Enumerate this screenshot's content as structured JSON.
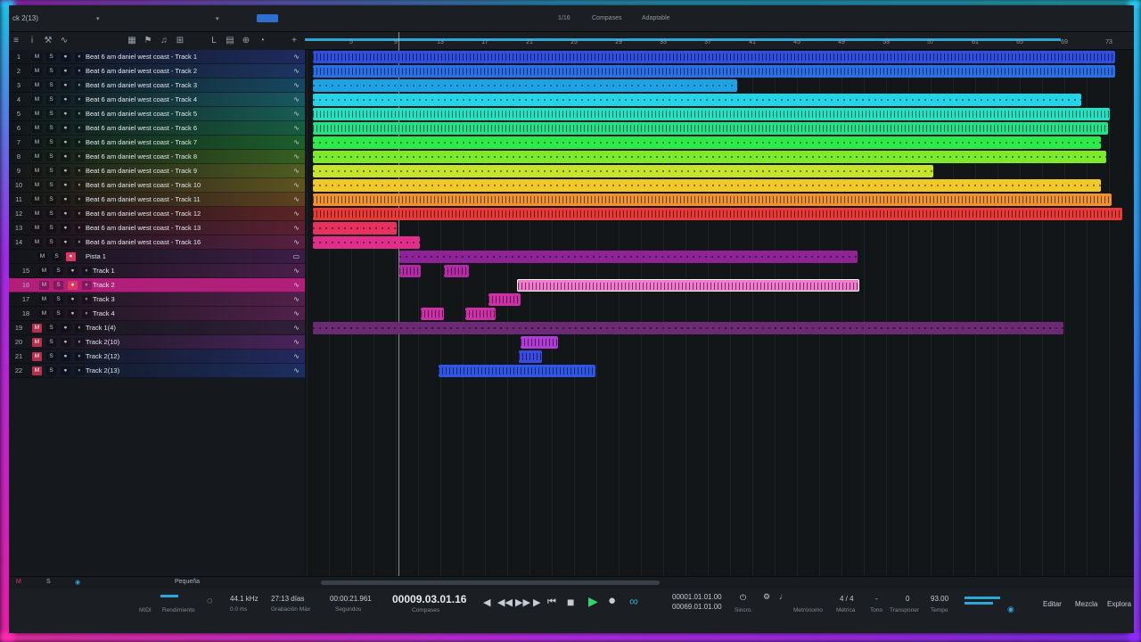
{
  "app": {
    "song_title": "ck 2(13)"
  },
  "toolbar": {
    "quantize": "1/16",
    "timebase": "Compases",
    "snap": "Adaptable"
  },
  "ruler": {
    "ticks": [
      "5",
      "9",
      "13",
      "17",
      "21",
      "25",
      "29",
      "33",
      "37",
      "41",
      "45",
      "49",
      "53",
      "57",
      "61",
      "65",
      "69",
      "73"
    ]
  },
  "tracks": [
    {
      "num": "1",
      "name": "Beat 6 am daniel west coast - Track 1",
      "color": "#2f4fe0"
    },
    {
      "num": "2",
      "name": "Beat 6 am daniel west coast - Track 2",
      "color": "#2a6ee8"
    },
    {
      "num": "3",
      "name": "Beat 6 am daniel west coast - Track 3",
      "color": "#1ba3e6"
    },
    {
      "num": "4",
      "name": "Beat 6 am daniel west coast - Track 4",
      "color": "#22d4e8"
    },
    {
      "num": "5",
      "name": "Beat 6 am daniel west coast - Track 5",
      "color": "#1fe3c3"
    },
    {
      "num": "6",
      "name": "Beat 6 am daniel west coast - Track 6",
      "color": "#1fe38a"
    },
    {
      "num": "7",
      "name": "Beat 6 am daniel west coast - Track 7",
      "color": "#2bea4c"
    },
    {
      "num": "8",
      "name": "Beat 6 am daniel west coast - Track 8",
      "color": "#7cea2a"
    },
    {
      "num": "9",
      "name": "Beat 6 am daniel west coast - Track 9",
      "color": "#c6e42a"
    },
    {
      "num": "10",
      "name": "Beat 6 am daniel west coast - Track 10",
      "color": "#f0c928"
    },
    {
      "num": "11",
      "name": "Beat 6 am daniel west coast - Track 11",
      "color": "#f0922a"
    },
    {
      "num": "12",
      "name": "Beat 6 am daniel west coast - Track 12",
      "color": "#ea3a38"
    },
    {
      "num": "13",
      "name": "Beat 6 am daniel west coast - Track 13",
      "color": "#e8305e"
    },
    {
      "num": "14",
      "name": "Beat 6 am daniel west coast - Track 16",
      "color": "#e02e8a"
    },
    {
      "num": "",
      "name": "Pista 1",
      "color": "#8e2398"
    },
    {
      "num": "15",
      "name": "Track 1",
      "color": "#b42aa6"
    },
    {
      "num": "16",
      "name": "Track 2",
      "color": "#f37ad0"
    },
    {
      "num": "17",
      "name": "Track 3",
      "color": "#cc2fa6"
    },
    {
      "num": "18",
      "name": "Track 4",
      "color": "#cc2fa6"
    },
    {
      "num": "19",
      "name": "Track 1(4)",
      "color": "#6a2a74"
    },
    {
      "num": "20",
      "name": "Track 2(10)",
      "color": "#b23ad6"
    },
    {
      "num": "21",
      "name": "Track 2(12)",
      "color": "#3b4ae0"
    },
    {
      "num": "22",
      "name": "Track 2(13)",
      "color": "#2e56e6"
    }
  ],
  "minibar": {
    "m": "M",
    "s": "S",
    "size": "Pequeña"
  },
  "transport": {
    "midi": "MIDI",
    "performance": "Rendimiento",
    "sample_rate": "44.1 kHz",
    "latency": "0.0 ms",
    "record_max_value": "27:13 días",
    "record_max_label": "Grabación Máx",
    "seconds_value": "00:00:21.961",
    "seconds_label": "Segundos",
    "position": "00009.03.01.16",
    "position_label": "Compases",
    "loop_start": "00001.01.01.00",
    "loop_end": "00069.01.01.00",
    "sync": "Sincro.",
    "metronome": "Metrónomo",
    "time_sig": "4 / 4",
    "time_sig_label": "Métrica",
    "key": "-",
    "key_label": "Tono",
    "transpose": "0",
    "transpose_label": "Transponer",
    "tempo": "93.00",
    "tempo_label": "Tempo",
    "edit": "Editar",
    "mix": "Mezcla",
    "browse": "Explora"
  }
}
